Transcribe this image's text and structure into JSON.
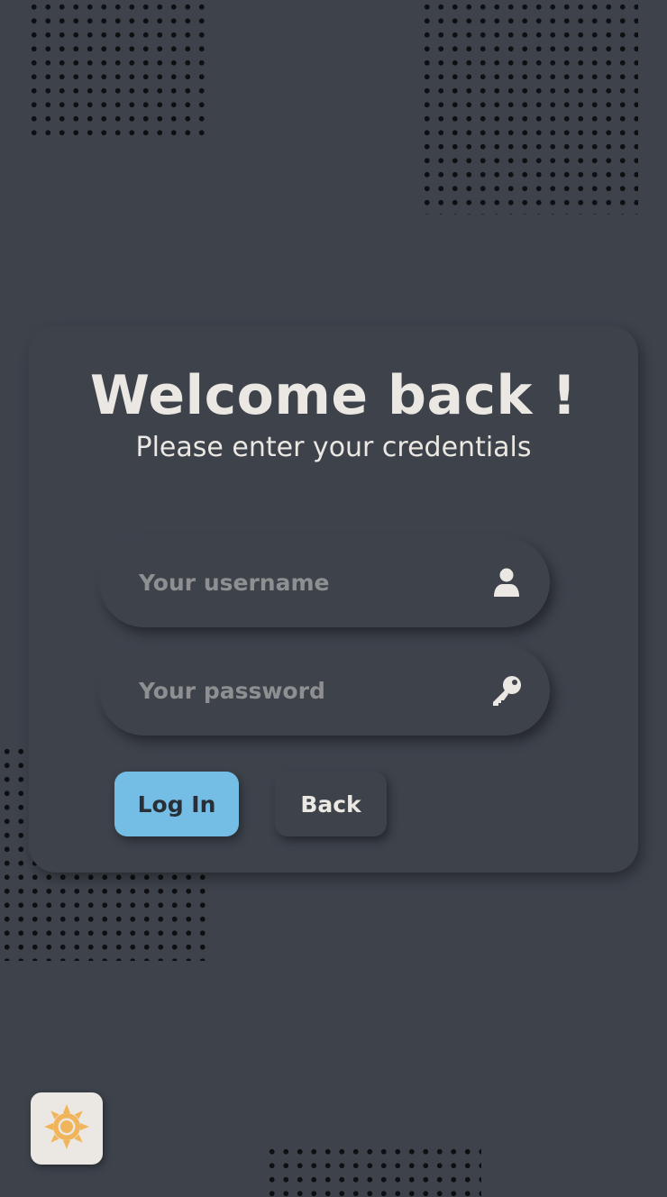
{
  "card": {
    "title": "Welcome back !",
    "subtitle": "Please enter your credentials"
  },
  "form": {
    "username_placeholder": "Your username",
    "username_value": "",
    "password_placeholder": "Your password",
    "password_value": "",
    "username_icon": "user-icon",
    "password_icon": "key-icon"
  },
  "buttons": {
    "login_label": "Log In",
    "back_label": "Back"
  },
  "theme_toggle": {
    "icon": "sun-icon"
  },
  "colors": {
    "background": "#3d424b",
    "text": "#ebe8e3",
    "placeholder": "#8e8f90",
    "primary_button": "#74bde4",
    "sun": "#f0b45a",
    "toggle_background": "#ebe8e3"
  }
}
